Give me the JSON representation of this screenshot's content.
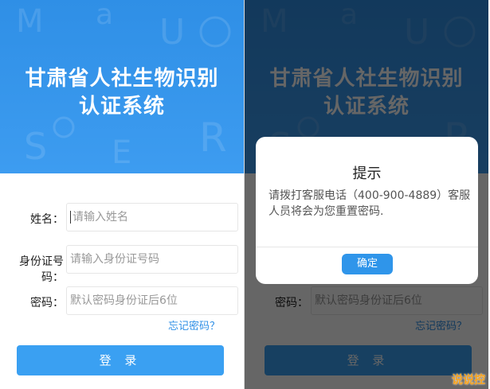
{
  "app": {
    "title_line1": "甘肃省人社生物识别",
    "title_line2": "认证系统"
  },
  "form": {
    "name_label": "姓名：",
    "name_placeholder": "请输入姓名",
    "id_label": "身份证号码：",
    "id_placeholder": "请输入身份证号码",
    "password_label": "密码：",
    "password_placeholder": "默认密码身份证后6位",
    "forgot": "忘记密码？",
    "login": "登 录"
  },
  "dialog": {
    "title": "提示",
    "message": "请拨打客服电话（400-900-4889）客服人员将会为您重置密码.",
    "confirm": "确定"
  },
  "watermark": "说说控",
  "colors": {
    "header_blue": "#3596ec",
    "button_blue": "#3aa0f2",
    "link_blue": "#2f8fe6",
    "overlay": "rgba(0,0,0,0.6)",
    "watermark": "#f7a21b"
  }
}
